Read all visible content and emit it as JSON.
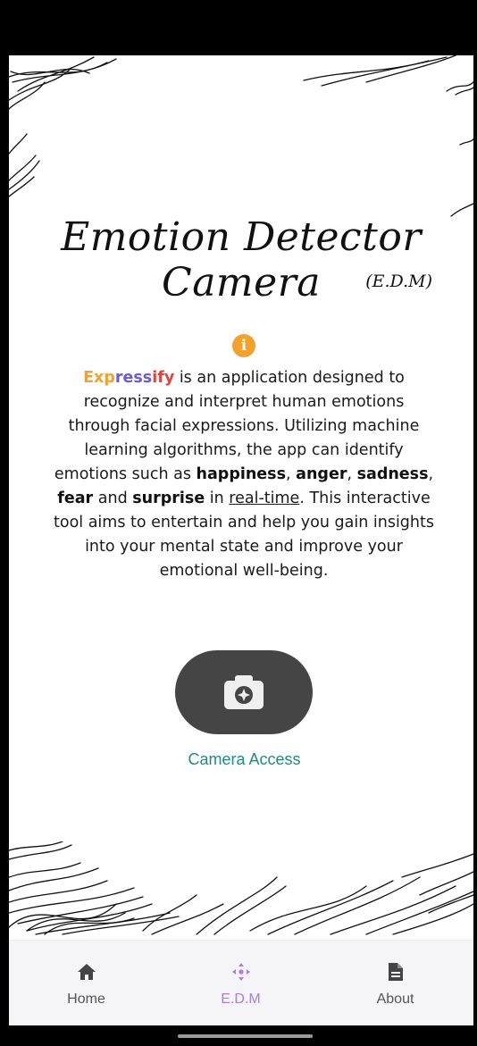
{
  "header": {
    "title": "Emotion Detector Camera",
    "subtitle": "(E.D.M)"
  },
  "description": {
    "brand_part1": "Exp",
    "brand_part2": "ress",
    "brand_part3": "ify",
    "text_1": " is an application designed to recognize and interpret human emotions through facial expressions. Utilizing machine learning algorithms, the app can identify emotions such as ",
    "emotion_1": "happiness",
    "sep_1": ", ",
    "emotion_2": "anger",
    "sep_2": ", ",
    "emotion_3": "sadness",
    "sep_3": ", ",
    "emotion_4": "fear",
    "sep_4": " and ",
    "emotion_5": "surprise",
    "text_2": " in ",
    "realtime": "real-time",
    "text_3": ". This interactive tool aims to entertain and help you gain insights into your mental state and improve your emotional well-being."
  },
  "camera": {
    "label": "Camera Access",
    "icon": "camera-icon"
  },
  "nav": {
    "items": [
      {
        "label": "Home",
        "icon": "home-icon"
      },
      {
        "label": "E.D.M",
        "icon": "move-arrows-icon",
        "active": true
      },
      {
        "label": "About",
        "icon": "document-icon"
      }
    ]
  },
  "colors": {
    "accent_orange": "#f2a12a",
    "accent_purple": "#a57ff0",
    "camera_label": "#1f8a86",
    "button_dark": "#454545"
  }
}
